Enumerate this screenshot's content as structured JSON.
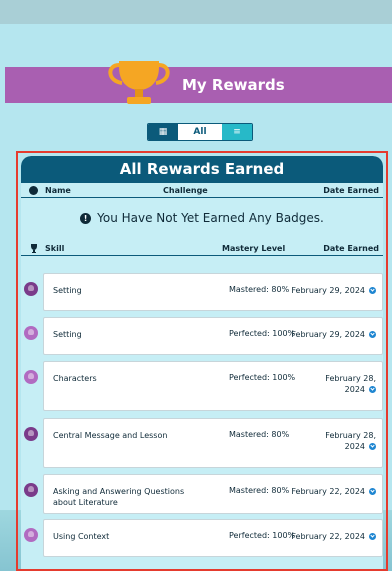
{
  "header": {
    "title": "My Rewards"
  },
  "view_toggle": {
    "grid_icon": "grid-icon",
    "all_label": "All",
    "list_icon": "list-icon"
  },
  "panel": {
    "title": "All Rewards Earned",
    "badges_columns": {
      "name": "Name",
      "challenge": "Challenge",
      "date": "Date Earned"
    },
    "empty_message": "You Have Not Yet Earned Any Badges.",
    "skills_columns": {
      "skill": "Skill",
      "mastery": "Mastery Level",
      "date": "Date Earned"
    },
    "skills": [
      {
        "skill": "Setting",
        "level": "Mastered: 80%",
        "date": "February 29, 2024",
        "badge": "mastered"
      },
      {
        "skill": "Setting",
        "level": "Perfected: 100%",
        "date": "February 29, 2024",
        "badge": "perfected"
      },
      {
        "skill": "Characters",
        "level": "Perfected: 100%",
        "date": "February 28, 2024",
        "badge": "perfected"
      },
      {
        "skill": "Central Message and Lesson",
        "level": "Mastered: 80%",
        "date": "February 28, 2024",
        "badge": "mastered"
      },
      {
        "skill": "Asking and Answering Questions about Literature",
        "level": "Mastered: 80%",
        "date": "February 22, 2024",
        "badge": "mastered"
      },
      {
        "skill": "Using Context",
        "level": "Perfected: 100%",
        "date": "February 22, 2024",
        "badge": "perfected"
      }
    ]
  }
}
